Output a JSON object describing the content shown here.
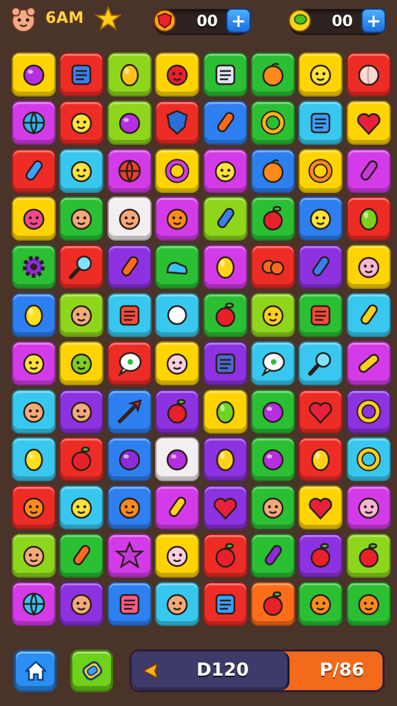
{
  "header": {
    "player_name": "6AM",
    "currency_a": {
      "value": "00",
      "icon": "shield-gem-icon",
      "add_label": "+"
    },
    "currency_b": {
      "value": "00",
      "icon": "green-gem-icon",
      "add_label": "+"
    }
  },
  "board": {
    "columns": 8,
    "rows": 12,
    "colors": {
      "Y": "#ffd400",
      "R": "#ee2c26",
      "L": "#8ed61c",
      "G": "#2bbf34",
      "B": "#2e7ff0",
      "C": "#38c8ef",
      "P": "#d43be8",
      "U": "#8d32e0",
      "O": "#ff6d1a",
      "W": "#f3eef0"
    },
    "tiles": [
      [
        "Y",
        "R",
        "L",
        "Y",
        "G",
        "G",
        "Y",
        "R"
      ],
      [
        "P",
        "R",
        "L",
        "R",
        "B",
        "G",
        "C",
        "Y"
      ],
      [
        "R",
        "C",
        "P",
        "Y",
        "P",
        "B",
        "Y",
        "P"
      ],
      [
        "Y",
        "G",
        "W",
        "P",
        "L",
        "G",
        "B",
        "R"
      ],
      [
        "G",
        "R",
        "U",
        "G",
        "P",
        "R",
        "U",
        "Y"
      ],
      [
        "B",
        "L",
        "C",
        "C",
        "G",
        "L",
        "G",
        "C"
      ],
      [
        "P",
        "Y",
        "R",
        "Y",
        "U",
        "C",
        "C",
        "P"
      ],
      [
        "C",
        "U",
        "B",
        "U",
        "Y",
        "G",
        "R",
        "U"
      ],
      [
        "C",
        "R",
        "B",
        "W",
        "U",
        "G",
        "R",
        "C"
      ],
      [
        "R",
        "C",
        "B",
        "P",
        "U",
        "G",
        "Y",
        "P"
      ],
      [
        "L",
        "G",
        "P",
        "Y",
        "R",
        "G",
        "U",
        "L"
      ],
      [
        "P",
        "U",
        "B",
        "C",
        "R",
        "O",
        "G",
        "G"
      ]
    ],
    "icons": [
      [
        "plum",
        "robot",
        "mango",
        "bug",
        "notepad",
        "orange",
        "cat-star",
        "peach"
      ],
      [
        "globe",
        "ghost",
        "plum",
        "shield",
        "carrot",
        "donut",
        "box",
        "heart"
      ],
      [
        "arm-cannon",
        "ghost",
        "basketball",
        "swirl",
        "duck",
        "orange",
        "power",
        "capsule"
      ],
      [
        "octopus",
        "face",
        "face",
        "bird",
        "syringe",
        "apple",
        "ghost",
        "pear"
      ],
      [
        "gear",
        "magnifier",
        "rocket",
        "boot",
        "balloon",
        "hearts",
        "pencil",
        "pig"
      ],
      [
        "lemon",
        "face",
        "note",
        "banana",
        "apple",
        "sun",
        "note",
        "icecream"
      ],
      [
        "ghost",
        "frog",
        "speech",
        "cat",
        "gamepad",
        "speech",
        "magnifier",
        "bandage"
      ],
      [
        "face",
        "face",
        "arrow",
        "apple",
        "melon",
        "plum",
        "heart",
        "ring"
      ],
      [
        "lemon",
        "apple",
        "grape",
        "plum",
        "balloon",
        "plum",
        "balloon",
        "ring"
      ],
      [
        "fish",
        "ghost",
        "bird",
        "icecream",
        "heart",
        "face",
        "heart",
        "pig"
      ],
      [
        "face",
        "carrot",
        "star",
        "cat",
        "apple",
        "eggplant",
        "apple",
        "apple"
      ],
      [
        "bubble",
        "face",
        "cake",
        "face",
        "cup",
        "apple",
        "bird",
        "bird"
      ]
    ]
  },
  "footer": {
    "home_icon": "home-icon",
    "shuffle_icon": "swap-icon",
    "score": "D120",
    "moves": "P/86",
    "progress_fraction": 0.62
  }
}
